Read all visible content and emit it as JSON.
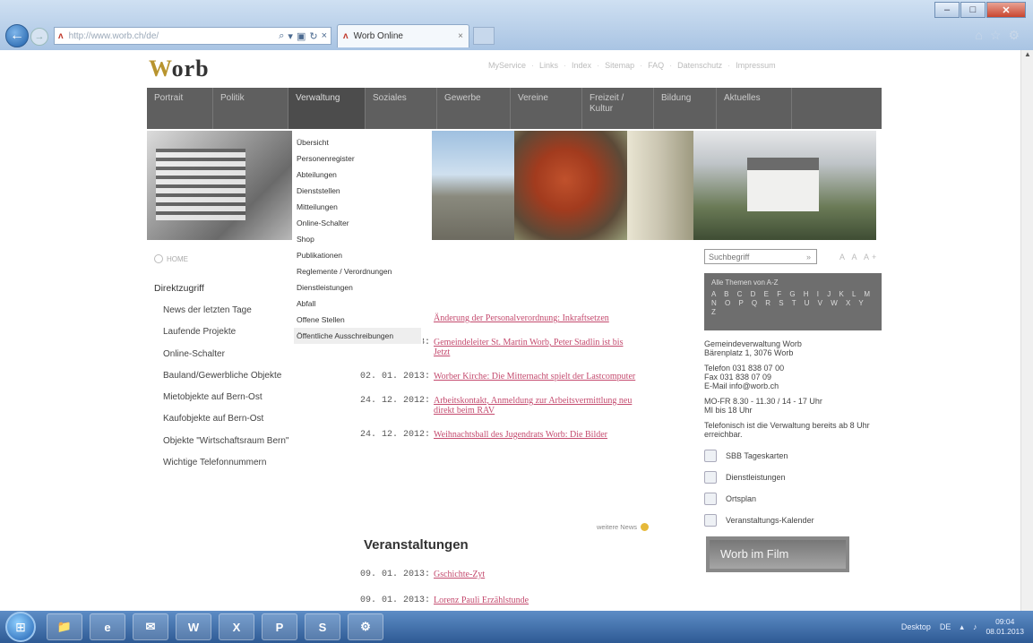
{
  "browser": {
    "url": "http://www.worb.ch/de/",
    "tab_title": "Worb Online",
    "tab_close": "×",
    "back": "←",
    "forward": "→",
    "favicon": "ʌ",
    "addr_icons": [
      "⌕",
      "▾",
      "▣",
      "↻",
      "×"
    ],
    "window_controls": {
      "minimize": "–",
      "maximize": "□",
      "close": "✕"
    },
    "tool_icons": [
      "⌂",
      "☆",
      "⚙"
    ]
  },
  "site": {
    "logo_first": "W",
    "logo_rest": "orb",
    "service_links": [
      "MyService",
      "Links",
      "Index",
      "Sitemap",
      "FAQ",
      "Datenschutz",
      "Impressum"
    ],
    "main_nav": [
      "Portrait",
      "Politik",
      "Verwaltung",
      "Soziales",
      "Gewerbe",
      "Vereine",
      "Freizeit / Kultur",
      "Bildung",
      "Aktuelles"
    ],
    "dropdown": [
      "Übersicht",
      "Personenregister",
      "Abteilungen",
      "Dienststellen",
      "Mitteilungen",
      "Online-Schalter",
      "Shop",
      "Publikationen",
      "Reglemente / Verordnungen",
      "Dienstleistungen",
      "Abfall",
      "Offene Stellen",
      "Öffentliche Ausschreibungen"
    ],
    "home_label": "HOME",
    "direct_access": {
      "heading": "Direktzugriff",
      "items": [
        "News der letzten Tage",
        "Laufende Projekte",
        "Online-Schalter",
        "Bauland/Gewerbliche Objekte",
        "Mietobjekte auf Bern-Ost",
        "Kaufobjekte auf Bern-Ost",
        "Objekte \"Wirtschaftsraum Bern\"",
        "Wichtige Telefonnummern"
      ]
    },
    "news": [
      {
        "date": "",
        "title": "Änderung der Personalverordnung: Inkraftsetzen"
      },
      {
        "date": "05. 01. 2013:",
        "title": "Gemeindeleiter St. Martin Worb, Peter Stadlin ist bis Jetzt"
      },
      {
        "date": "02. 01. 2013:",
        "title": "Worber Kirche: Die Mitternacht spielt der Lastcomputer"
      },
      {
        "date": "24. 12. 2012:",
        "title": "Arbeitskontakt, Anmeldung zur Arbeitsvermittlung neu direkt beim RAV"
      },
      {
        "date": "24. 12. 2012:",
        "title": "Weihnachtsball des Jugendrats Worb: Die Bilder"
      }
    ],
    "more_news": "weitere News",
    "events_heading": "Veranstaltungen",
    "events": [
      {
        "date": "09. 01. 2013:",
        "title": "Gschichte-Zyt"
      },
      {
        "date": "09. 01. 2013:",
        "title": "Lorenz Pauli Erzählstunde"
      }
    ],
    "search_placeholder": "Suchbegriff",
    "search_go": "»",
    "font_size_controls": "A A A+",
    "az_title": "Alle Themen von A-Z",
    "az_letters": "A B C D E F G H I J K L M N O P Q R S T U V W X Y Z",
    "contact": {
      "name": "Gemeindeverwaltung Worb",
      "address": "Bärenplatz 1, 3076 Worb",
      "phone": "Telefon 031 838 07 00",
      "fax": "Fax 031 838 07 09",
      "email": "E-Mail info@worb.ch",
      "hours1": "MO-FR 8.30 - 11.30 / 14 - 17 Uhr",
      "hours2": "MI bis 18 Uhr",
      "note": "Telefonisch ist die Verwaltung bereits ab 8 Uhr erreichbar."
    },
    "services": [
      "SBB Tageskarten",
      "Dienstleistungen",
      "Ortsplan",
      "Veranstaltungs-Kalender"
    ],
    "film_label": "Worb im Film"
  },
  "taskbar": {
    "apps": [
      "📁",
      "e",
      "✉",
      "W",
      "X",
      "P",
      "S",
      "⚙"
    ],
    "desktop_label": "Desktop",
    "lang": "DE",
    "time": "09:04",
    "date": "08.01.2013"
  }
}
